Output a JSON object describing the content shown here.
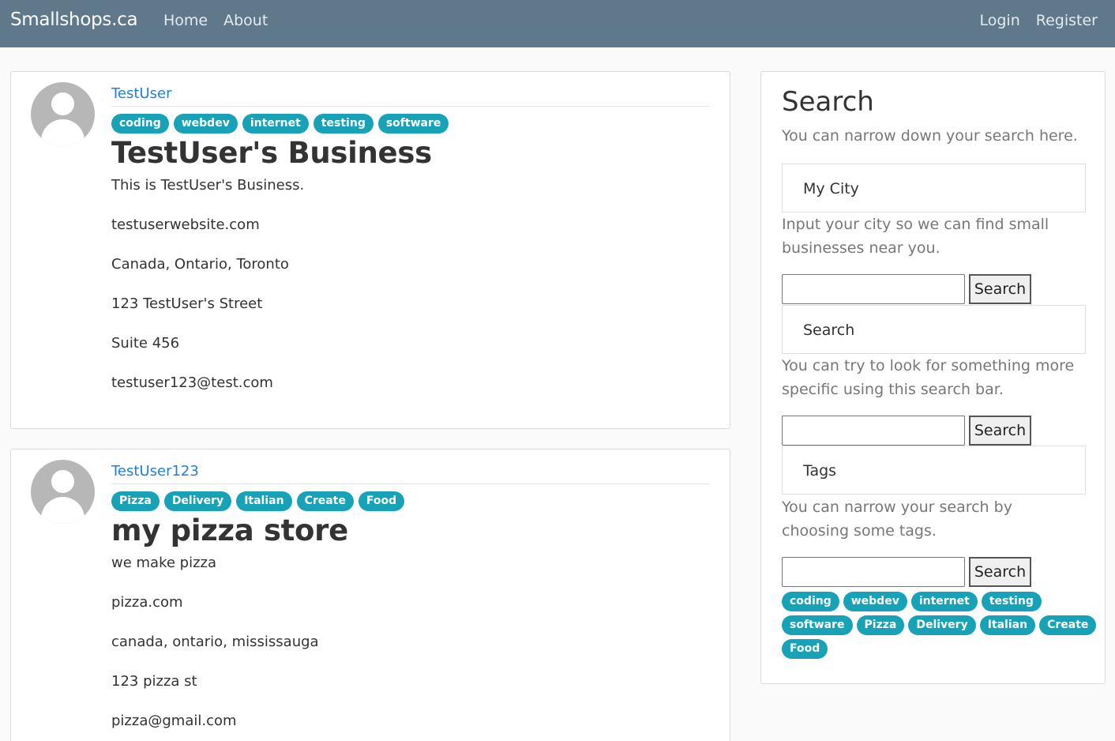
{
  "nav": {
    "brand": "Smallshops.ca",
    "left_links": [
      "Home",
      "About"
    ],
    "right_links": [
      "Login",
      "Register"
    ]
  },
  "listings": [
    {
      "username": "TestUser",
      "tags": [
        "coding",
        "webdev",
        "internet",
        "testing",
        "software"
      ],
      "title": "TestUser's Business",
      "description": "This is TestUser's Business.",
      "website": "testuserwebsite.com",
      "location": "Canada, Ontario, Toronto",
      "address1": "123 TestUser's Street",
      "address2": "Suite 456",
      "email": "testuser123@test.com"
    },
    {
      "username": "TestUser123",
      "tags": [
        "Pizza",
        "Delivery",
        "Italian",
        "Create",
        "Food"
      ],
      "title": "my pizza store",
      "description": "we make pizza",
      "website": "pizza.com",
      "location": "canada, ontario, mississauga",
      "address1": "123 pizza st",
      "email": "pizza@gmail.com"
    }
  ],
  "sidebar": {
    "title": "Search",
    "subtitle": "You can narrow down your search here.",
    "city": {
      "header": "My City",
      "description": "Input your city so we can find small businesses near you.",
      "input_value": "",
      "button": "Search"
    },
    "search": {
      "header": "Search",
      "description": "You can try to look for something more specific using this search bar.",
      "input_value": "",
      "button": "Search"
    },
    "tags": {
      "header": "Tags",
      "description": "You can narrow your search by choosing some tags.",
      "input_value": "",
      "button": "Search",
      "items": [
        "coding",
        "webdev",
        "internet",
        "testing",
        "software",
        "Pizza",
        "Delivery",
        "Italian",
        "Create",
        "Food"
      ]
    }
  },
  "colors": {
    "navbar": "#5f788a",
    "tag": "#17a2b8",
    "link": "#1f80d6"
  }
}
